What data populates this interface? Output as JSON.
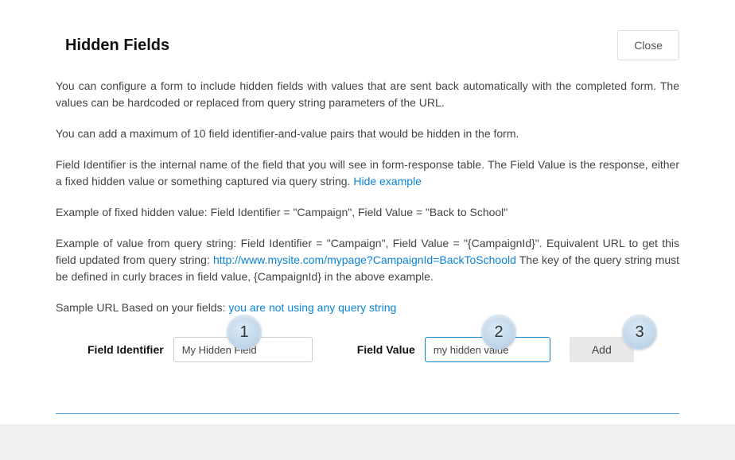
{
  "dialog": {
    "title": "Hidden Fields",
    "close_label": "Close"
  },
  "body": {
    "para1": "You can configure a form to include hidden fields with values that are sent back automatically with the completed form. The values can be hardcoded or replaced from query string parameters of the URL.",
    "para2": "You can add a maximum of 10 field identifier-and-value pairs that would be hidden in the form.",
    "para3_pre": "Field Identifier is the internal name of the field that you will see in form-response table. The Field Value is the response, either a fixed hidden value or something captured via query string. ",
    "hide_example": "Hide example",
    "example_fixed": "Example of fixed hidden value: Field Identifier = \"Campaign\", Field Value = \"Back to School\"",
    "example_qs_pre": "Example of value from query string: Field Identifier = \"Campaign\", Field Value = \"{CampaignId}\". Equivalent URL to get this field updated from query string: ",
    "example_qs_url": "http://www.mysite.com/mypage?CampaignId=BackToSchoold",
    "example_qs_post": " The key of the query string must be defined in curly braces in field value, {CampaignId} in the above example.",
    "sample_pre": "Sample URL Based on your fields: ",
    "sample_link": "you are not using any query string"
  },
  "form": {
    "field_identifier_label": "Field Identifier",
    "field_identifier_value": "My Hidden Field",
    "field_value_label": "Field Value",
    "field_value_value": "my hidden value",
    "add_label": "Add"
  },
  "steps": {
    "one": "1",
    "two": "2",
    "three": "3"
  }
}
